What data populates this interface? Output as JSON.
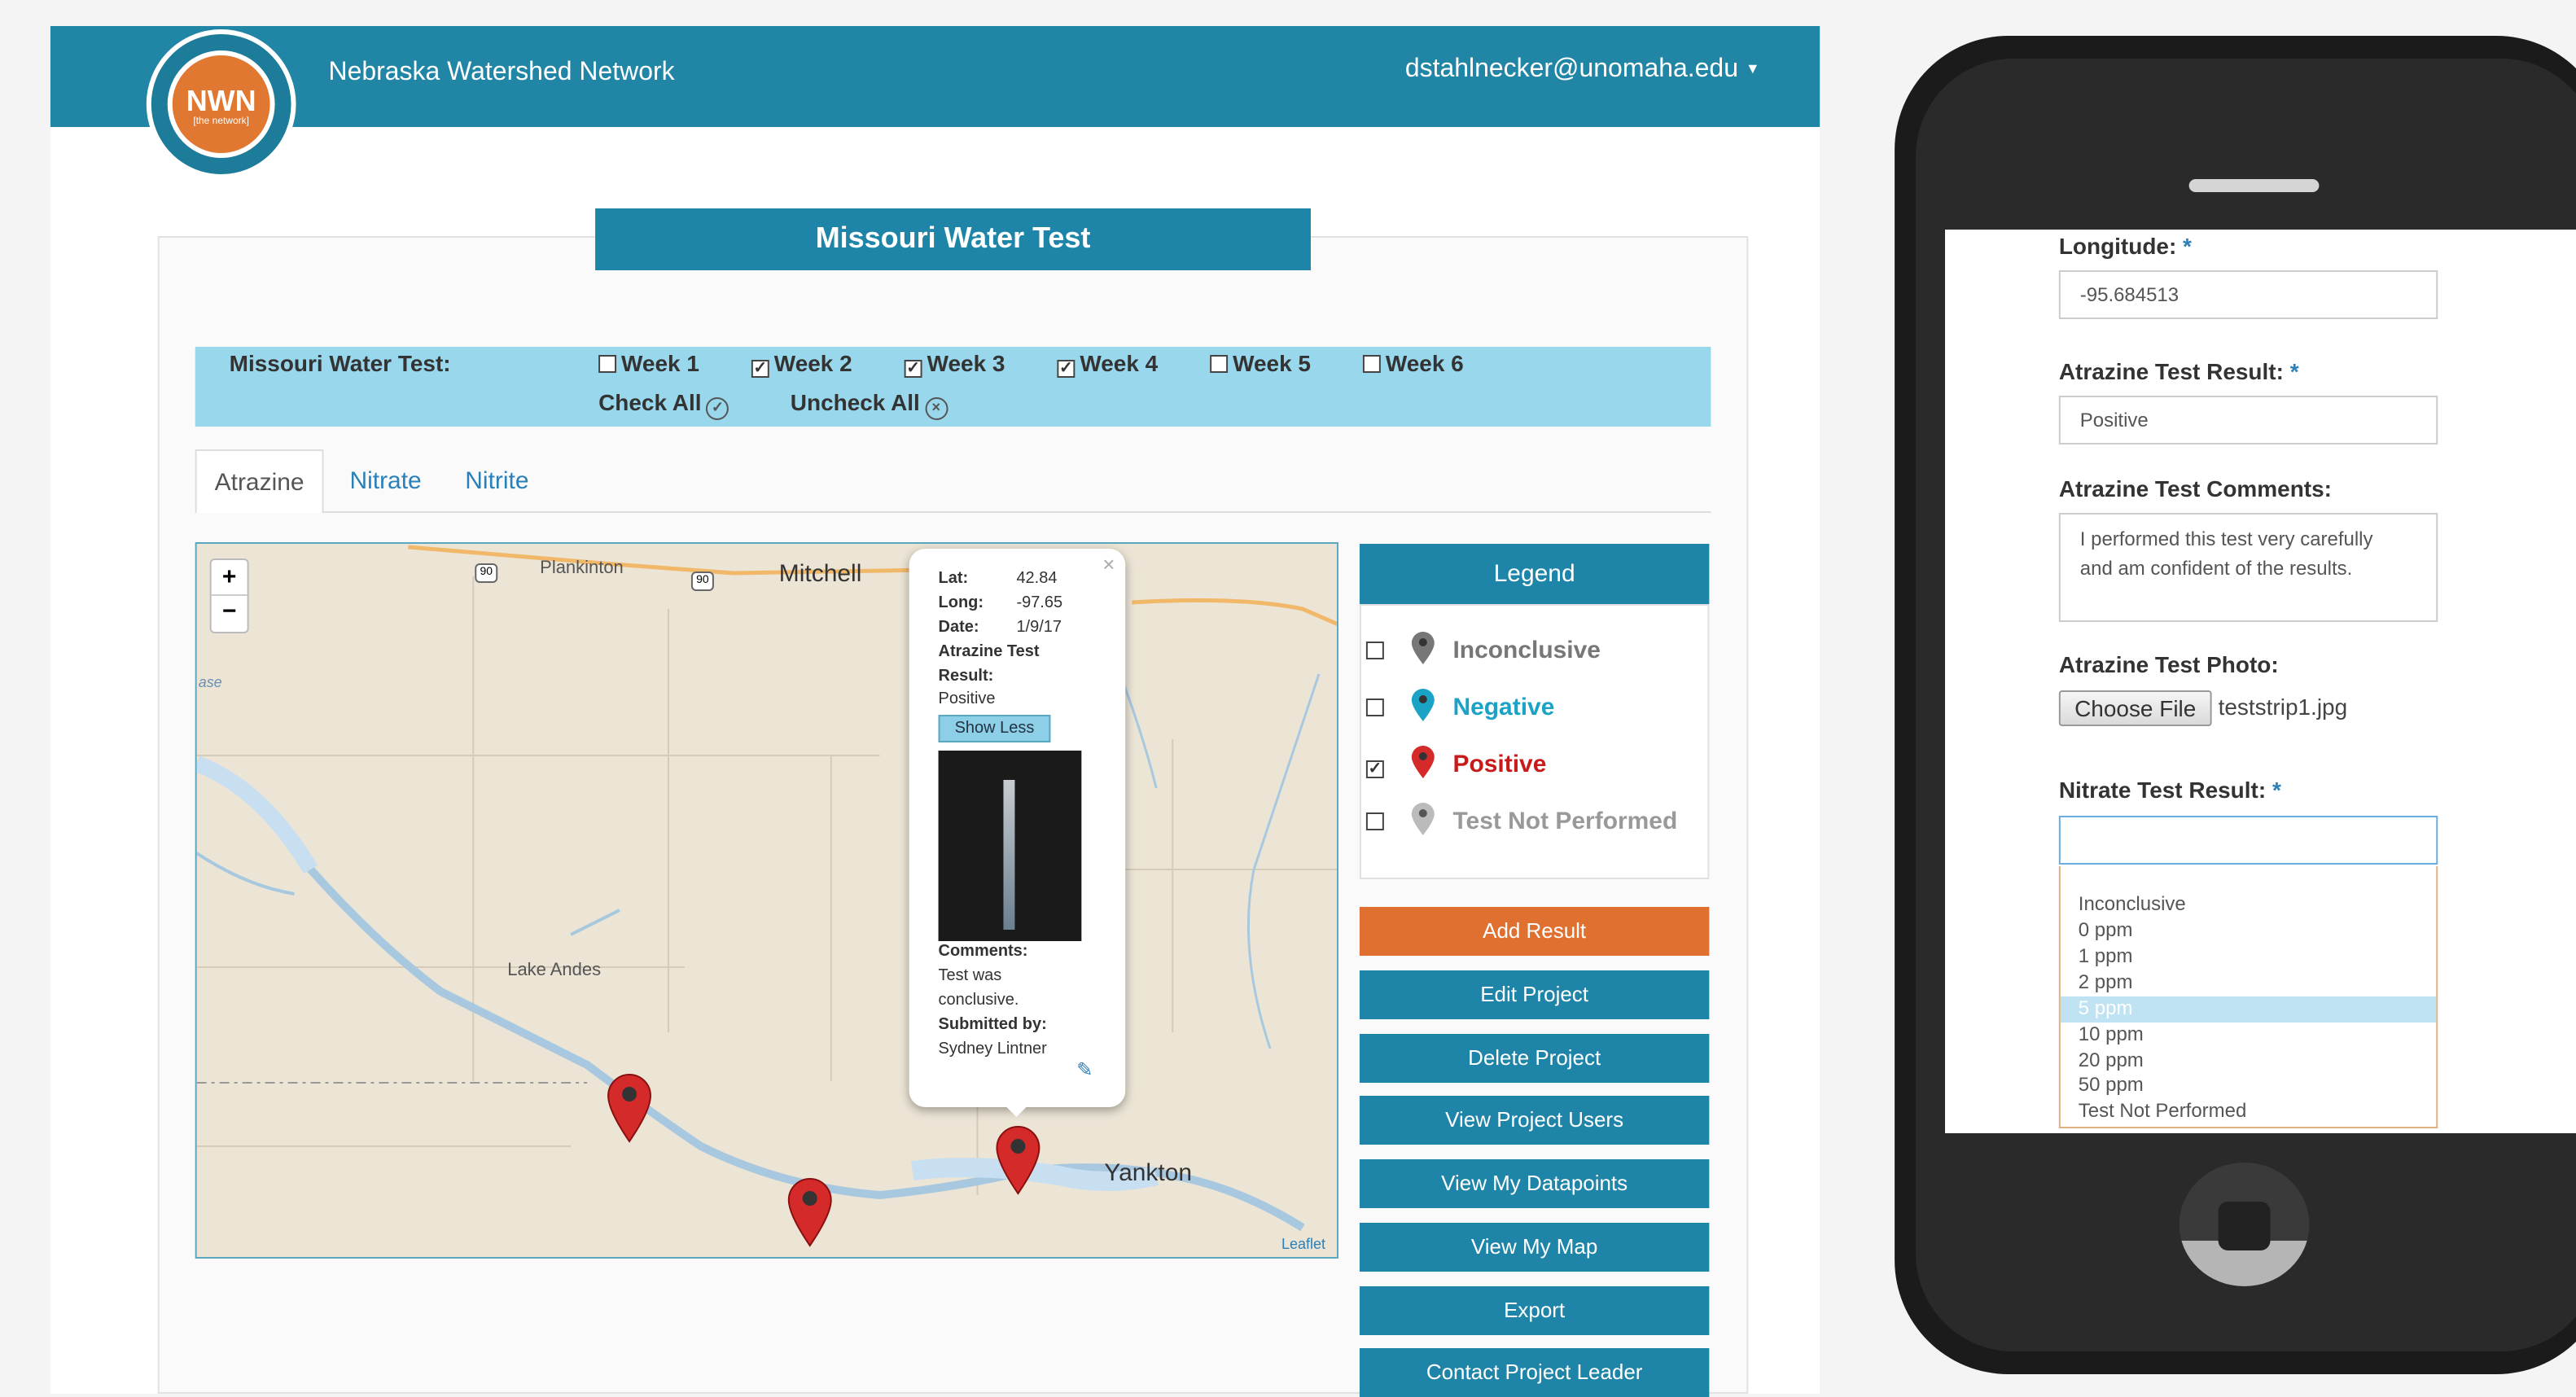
{
  "header": {
    "brand": "Nebraska Watershed Network",
    "user": "dstahlnecker@unomaha.edu",
    "logo_text": "NWN",
    "logo_sub": "[the network]"
  },
  "project": {
    "title": "Missouri Water Test",
    "week_label": "Missouri Water Test:",
    "weeks": [
      {
        "label": "Week 1",
        "checked": false
      },
      {
        "label": "Week 2",
        "checked": true
      },
      {
        "label": "Week 3",
        "checked": true
      },
      {
        "label": "Week 4",
        "checked": true
      },
      {
        "label": "Week 5",
        "checked": false
      },
      {
        "label": "Week 6",
        "checked": false
      }
    ],
    "check_all": "Check All",
    "uncheck_all": "Uncheck All"
  },
  "tabs": [
    "Atrazine",
    "Nitrate",
    "Nitrite"
  ],
  "map": {
    "places": [
      "Plankinton",
      "Mitchell",
      "Lake Andes",
      "Yankton"
    ],
    "highway_1": "90",
    "highway_2": "90",
    "zoom_in": "+",
    "zoom_out": "−",
    "attribution": "Leaflet",
    "edge_text": "ase"
  },
  "popup": {
    "close": "×",
    "lat_label": "Lat:",
    "lat": "42.84",
    "long_label": "Long:",
    "long": "-97.65",
    "date_label": "Date:",
    "date": "1/9/17",
    "result_label_1": "Atrazine Test",
    "result_label_2": "Result:",
    "result": "Positive",
    "show_less": "Show Less",
    "comments_label": "Comments:",
    "comments_1": "Test was",
    "comments_2": "conclusive.",
    "submitted_label": "Submitted by:",
    "submitted": "Sydney Lintner"
  },
  "legend": {
    "title": "Legend",
    "items": [
      {
        "label": "Inconclusive",
        "color": "#777777",
        "checked": false
      },
      {
        "label": "Negative",
        "color": "#1ba3c6",
        "checked": false
      },
      {
        "label": "Positive",
        "color": "#c81a1a",
        "checked": true
      },
      {
        "label": "Test Not Performed",
        "color": "#aaaaaa",
        "checked": false
      }
    ]
  },
  "buttons": {
    "add": "Add Result",
    "edit": "Edit Project",
    "delete": "Delete Project",
    "users": "View Project Users",
    "datapoints": "View My Datapoints",
    "map": "View My Map",
    "export": "Export",
    "contact": "Contact Project Leader"
  },
  "mobile": {
    "longitude_label": "Longitude:",
    "longitude": "-95.684513",
    "atrazine_result_label": "Atrazine Test Result:",
    "atrazine_result": "Positive",
    "atrazine_comments_label": "Atrazine Test Comments:",
    "atrazine_comments_1": "I performed this test very carefully",
    "atrazine_comments_2": "and am confident of the results.",
    "atrazine_photo_label": "Atrazine Test Photo:",
    "choose_file": "Choose File",
    "file_name": "teststrip1.jpg",
    "nitrate_label": "Nitrate Test Result:",
    "required_mark": "*",
    "options": [
      "Inconclusive",
      "0 ppm",
      "1 ppm",
      "2 ppm",
      "5 ppm",
      "10 ppm",
      "20 ppm",
      "50 ppm",
      "Test Not Performed"
    ],
    "selected_option": "5 ppm"
  },
  "colors": {
    "primary": "#1f85a8",
    "accent": "#e07030",
    "week_bar": "#98d7ec"
  }
}
